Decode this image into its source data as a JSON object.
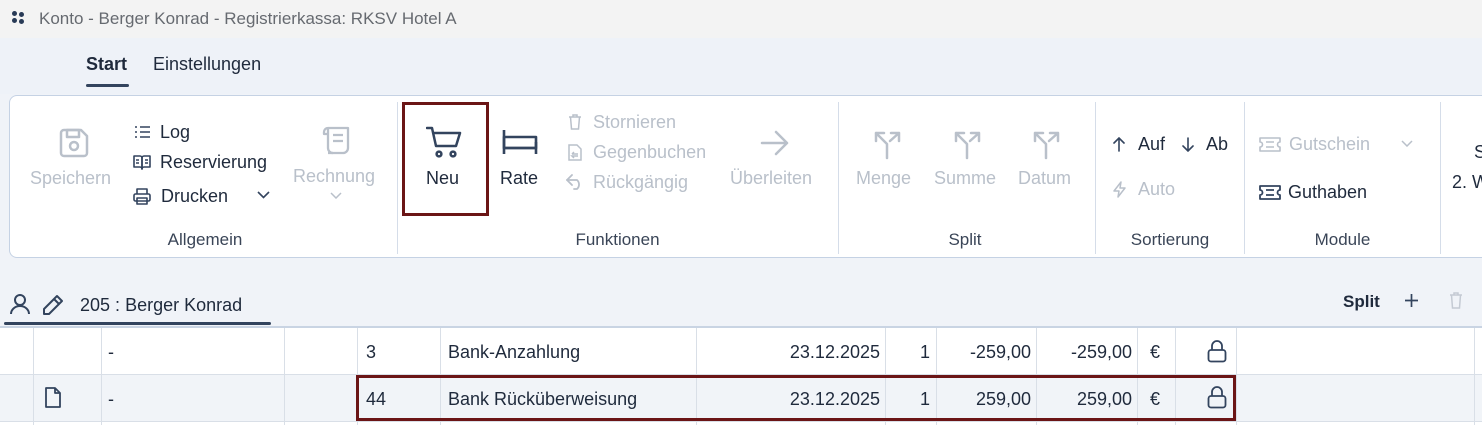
{
  "window": {
    "title": "Konto - Berger Konrad - Registrierkassa: RKSV Hotel A"
  },
  "tabs": [
    {
      "label": "Start",
      "active": true
    },
    {
      "label": "Einstellungen",
      "active": false
    }
  ],
  "ribbon": {
    "allgemein": {
      "group_label": "Allgemein",
      "speichern": "Speichern",
      "log": "Log",
      "reservierung": "Reservierung",
      "drucken": "Drucken",
      "rechnung": "Rechnung"
    },
    "funktionen": {
      "group_label": "Funktionen",
      "neu": "Neu",
      "rate": "Rate",
      "stornieren": "Stornieren",
      "gegenbuchen": "Gegenbuchen",
      "rueckgaengig": "Rückgängig",
      "ueberleiten": "Überleiten"
    },
    "split": {
      "group_label": "Split",
      "menge": "Menge",
      "summe": "Summe",
      "datum": "Datum"
    },
    "sortierung": {
      "group_label": "Sortierung",
      "auf": "Auf",
      "ab": "Ab",
      "auto": "Auto"
    },
    "module": {
      "group_label": "Module",
      "gutschein": "Gutschein",
      "guthaben": "Guthaben"
    },
    "overflow": {
      "line1": "S",
      "line2": "2. W"
    }
  },
  "account_bar": {
    "room": "205 :",
    "guest": "Berger Konrad",
    "split_label": "Split"
  },
  "table": {
    "rows": [
      {
        "marker": "-",
        "number": "3",
        "description": "Bank-Anzahlung",
        "date": "23.12.2025",
        "quantity": "1",
        "price": "-259,00",
        "total": "-259,00",
        "currency": "€"
      },
      {
        "marker": "-",
        "number": "44",
        "description": "Bank Rücküberweisung",
        "date": "23.12.2025",
        "quantity": "1",
        "price": "259,00",
        "total": "259,00",
        "currency": "€"
      }
    ]
  },
  "colors": {
    "accent": "#33445e",
    "highlight": "#6b1516",
    "disabled": "#b9c0ca"
  }
}
